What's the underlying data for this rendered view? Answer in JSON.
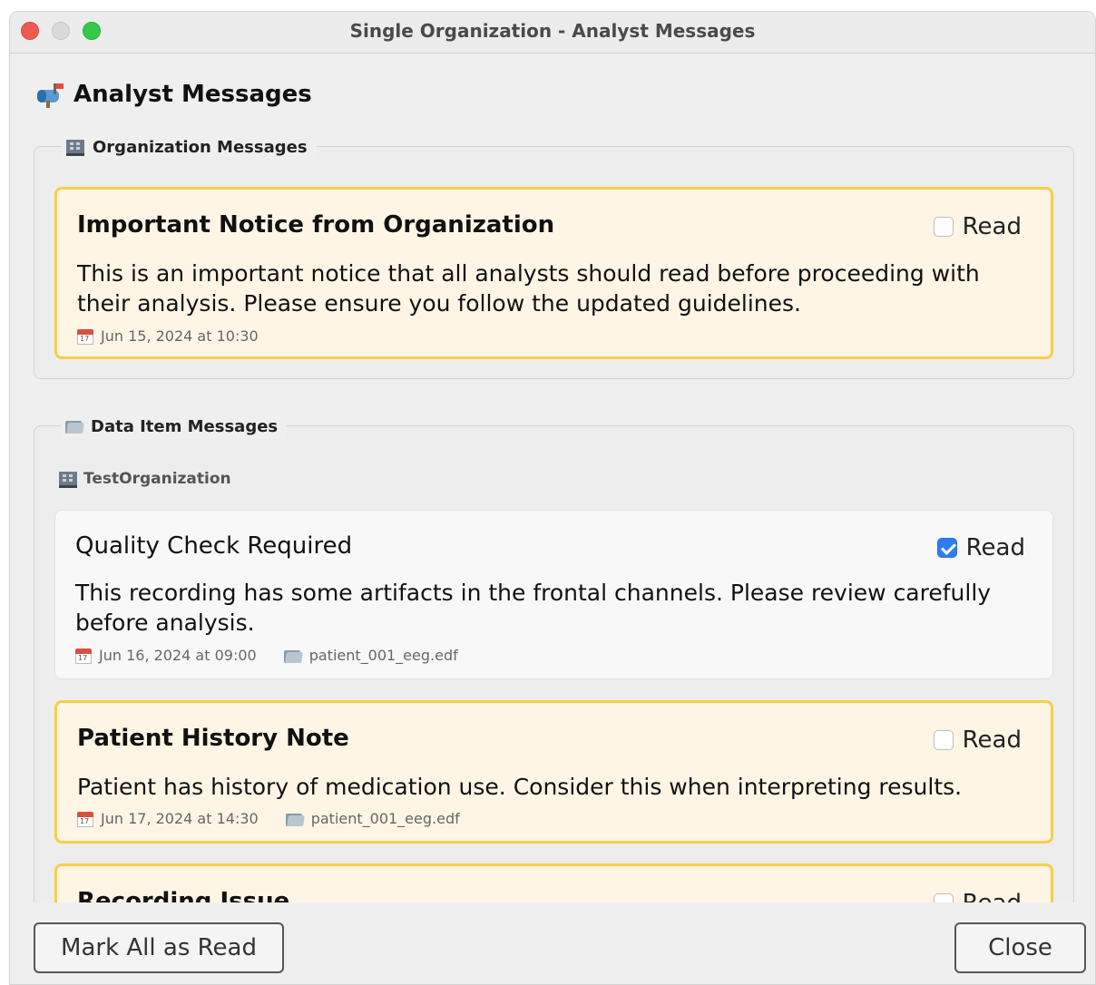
{
  "window": {
    "title": "Single Organization - Analyst Messages"
  },
  "heading": {
    "icon": "mailbox-icon",
    "title": "Analyst Messages"
  },
  "organization_messages": {
    "legend": "Organization Messages",
    "icon": "building-icon",
    "messages": [
      {
        "title": "Important Notice from Organization",
        "body": "This is an important notice that all analysts should read before proceeding with their analysis. Please ensure you follow the updated guidelines.",
        "date": "Jun 15, 2024 at 10:30",
        "read_label": "Read",
        "read": false
      }
    ]
  },
  "data_item_messages": {
    "legend": "Data Item Messages",
    "icon": "folder-icon",
    "organization_label": "TestOrganization",
    "messages": [
      {
        "title": "Quality Check Required",
        "body": "This recording has some artifacts in the frontal channels. Please review carefully before analysis.",
        "date": "Jun 16, 2024 at 09:00",
        "file": "patient_001_eeg.edf",
        "read_label": "Read",
        "read": true
      },
      {
        "title": "Patient History Note",
        "body": "Patient has history of medication use. Consider this when interpreting results.",
        "date": "Jun 17, 2024 at 14:30",
        "file": "patient_001_eeg.edf",
        "read_label": "Read",
        "read": false
      },
      {
        "title": "Recording Issue",
        "read_label": "Read",
        "read": false
      }
    ]
  },
  "footer": {
    "mark_all_label": "Mark All as Read",
    "close_label": "Close"
  },
  "colors": {
    "unread_border": "#f6cf4a",
    "unread_background": "#fff5e5",
    "checkbox_checked": "#2f7cf6"
  }
}
